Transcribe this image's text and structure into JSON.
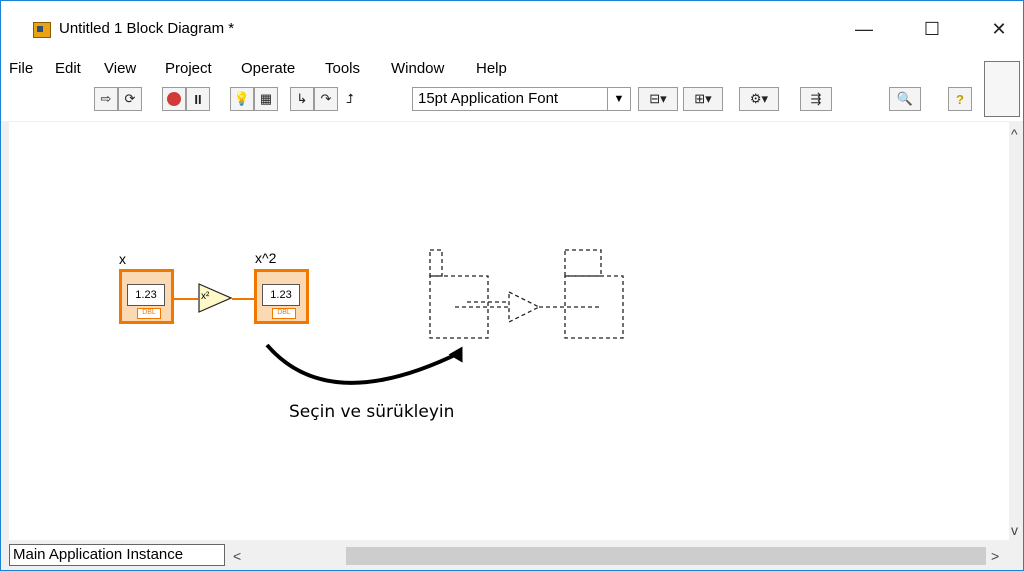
{
  "window": {
    "title": "Untitled 1 Block Diagram *"
  },
  "titlebar": {
    "minimize": "—",
    "maximize": "☐",
    "close": "✕"
  },
  "menu": [
    "File",
    "Edit",
    "View",
    "Project",
    "Operate",
    "Tools",
    "Window",
    "Help"
  ],
  "toolbar": {
    "icons": [
      "run-arrow-icon",
      "run-continuously-icon",
      "abort-icon",
      "pause-icon",
      "highlight-execution-icon",
      "retain-wire-values-icon",
      "step-into-icon",
      "step-over-icon",
      "step-out-icon"
    ],
    "font": "15pt Application Font",
    "font_arrow": "▼"
  },
  "diagram": {
    "control_label": "x",
    "control_value": "1.23",
    "control_type": "DBL",
    "function_glyph": "x²",
    "indicator_label": "x^2",
    "indicator_value": "1.23",
    "indicator_type": "DBL",
    "caption": "Seçin ve sürükleyin"
  },
  "statusbar": {
    "instance": "Main Application Instance",
    "scroll_left": "<",
    "scroll_right": ">",
    "scroll_up": "^",
    "scroll_down": "v"
  },
  "colors": {
    "wire": "#f07800",
    "terminal_fill": "#fbd9b2",
    "function_fill": "#fff8c8"
  }
}
